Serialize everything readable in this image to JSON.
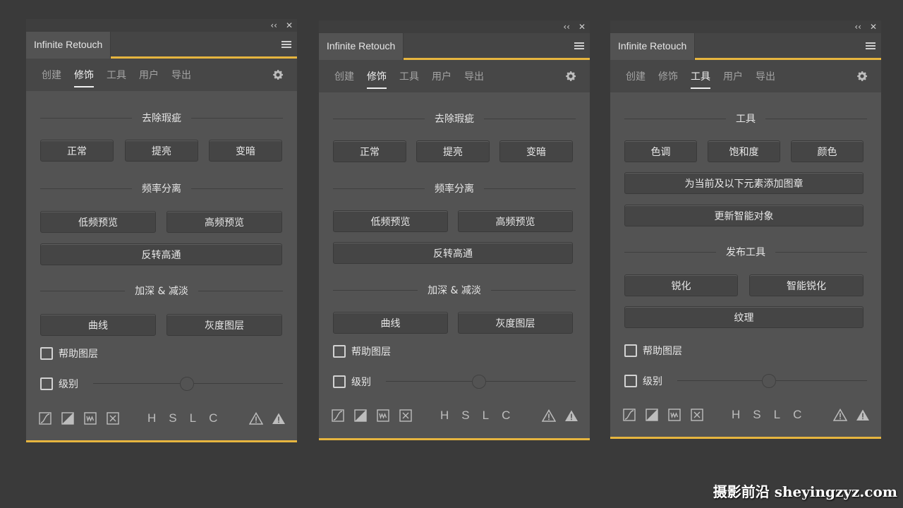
{
  "panels": [
    {
      "title": "Infinite Retouch",
      "window_controls": {
        "collapse": "‹‹",
        "close": "✕"
      },
      "tabs": [
        "创建",
        "修饰",
        "工具",
        "用户",
        "导出"
      ],
      "active_tab": 1,
      "sections": [
        {
          "title": "去除瑕疵",
          "buttons": [
            "正常",
            "提亮",
            "变暗"
          ]
        },
        {
          "title": "频率分离",
          "buttons": [
            "低频预览",
            "高频预览"
          ],
          "wide_button": "反转高通"
        },
        {
          "title": "加深 & 减淡",
          "buttons": [
            "曲线",
            "灰度图层"
          ]
        }
      ],
      "checkboxes": [
        "帮助图层",
        "级别"
      ],
      "toolbar": {
        "letters": [
          "H",
          "S",
          "L",
          "C"
        ]
      }
    },
    {
      "title": "Infinite Retouch",
      "window_controls": {
        "collapse": "‹‹",
        "close": "✕"
      },
      "tabs": [
        "创建",
        "修饰",
        "工具",
        "用户",
        "导出"
      ],
      "active_tab": 1,
      "sections": [
        {
          "title": "去除瑕疵",
          "buttons": [
            "正常",
            "提亮",
            "变暗"
          ]
        },
        {
          "title": "频率分离",
          "buttons": [
            "低频预览",
            "高频预览"
          ],
          "wide_button": "反转高通"
        },
        {
          "title": "加深 & 减淡",
          "buttons": [
            "曲线",
            "灰度图层"
          ]
        }
      ],
      "checkboxes": [
        "帮助图层",
        "级别"
      ],
      "toolbar": {
        "letters": [
          "H",
          "S",
          "L",
          "C"
        ]
      }
    },
    {
      "title": "Infinite Retouch",
      "window_controls": {
        "collapse": "‹‹",
        "close": "✕"
      },
      "tabs": [
        "创建",
        "修饰",
        "工具",
        "用户",
        "导出"
      ],
      "active_tab": 2,
      "sections": [
        {
          "title": "工具",
          "buttons": [
            "色调",
            "饱和度",
            "颜色"
          ],
          "wide_buttons": [
            "为当前及以下元素添加图章",
            "更新智能对象"
          ]
        },
        {
          "title": "发布工具",
          "buttons": [
            "锐化",
            "智能锐化"
          ],
          "wide_button": "纹理"
        }
      ],
      "checkboxes": [
        "帮助图层",
        "级别"
      ],
      "toolbar": {
        "letters": [
          "H",
          "S",
          "L",
          "C"
        ]
      }
    }
  ],
  "watermark": "摄影前沿 sheyingzyz.com",
  "colors": {
    "accent": "#e6b53f",
    "panel_bg": "#535353",
    "page_bg": "#3a3a3a"
  }
}
